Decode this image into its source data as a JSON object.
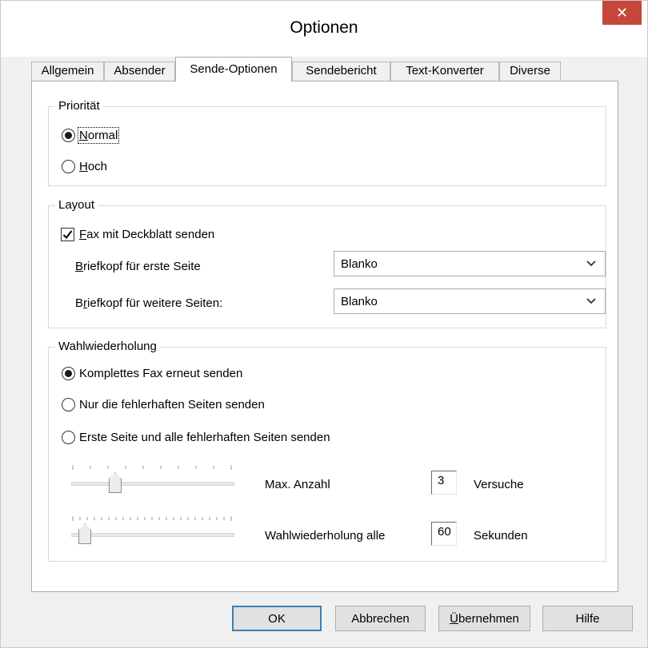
{
  "window": {
    "title": "Optionen",
    "close_glyph": "✕"
  },
  "tabs": [
    {
      "label": "Allgemein"
    },
    {
      "label": "Absender"
    },
    {
      "label": "Sende-Optionen",
      "active": true
    },
    {
      "label": "Sendebericht"
    },
    {
      "label": "Text-Konverter"
    },
    {
      "label": "Diverse"
    }
  ],
  "prioritaet": {
    "legend": "Priorität",
    "options": [
      {
        "accel": "N",
        "rest": "ormal",
        "checked": true
      },
      {
        "accel": "H",
        "rest": "och",
        "checked": false
      }
    ]
  },
  "layout": {
    "legend": "Layout",
    "cover_checkbox": {
      "accel": "F",
      "rest": "ax mit Deckblatt senden",
      "checked": true
    },
    "first_page": {
      "accel": "B",
      "rest": "riefkopf für erste Seite",
      "value": "Blanko"
    },
    "further_pages": {
      "pre": "B",
      "accel": "r",
      "rest": "iefkopf für weitere Seiten:",
      "value": "Blanko"
    }
  },
  "wahlwiederholung": {
    "legend": "Wahlwiederholung",
    "options": [
      {
        "label": "Komplettes Fax erneut senden",
        "checked": true
      },
      {
        "label": "Nur die fehlerhaften Seiten senden",
        "checked": false
      },
      {
        "label": "Erste Seite und alle fehlerhaften Seiten senden",
        "checked": false
      }
    ],
    "max_attempts": {
      "label": "Max. Anzahl",
      "value": "3",
      "unit": "Versuche",
      "slider_fraction": 0.25
    },
    "interval": {
      "label": "Wahlwiederholung alle",
      "value": "60",
      "unit": "Sekunden",
      "slider_fraction": 0.05
    }
  },
  "buttons": {
    "ok": "OK",
    "cancel": "Abbrechen",
    "apply_accel": "Ü",
    "apply_rest": "bernehmen",
    "help": "Hilfe"
  },
  "colors": {
    "close_bg": "#c7463a",
    "default_button_border": "#3c7fb1"
  }
}
